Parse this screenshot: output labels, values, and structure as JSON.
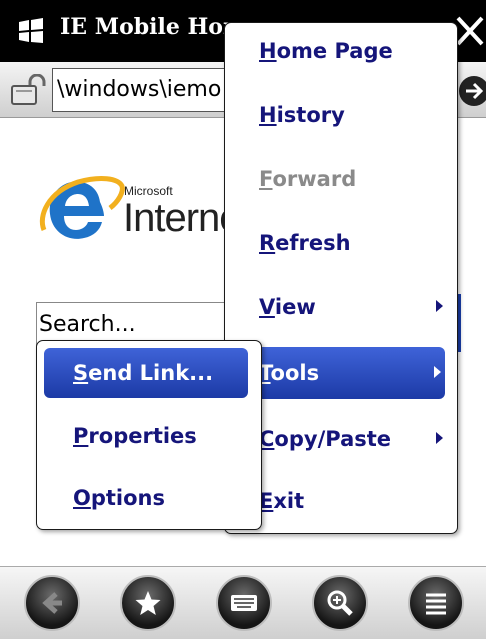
{
  "window": {
    "title": "IE Mobile Hom",
    "address": "\\windows\\iemo"
  },
  "page": {
    "logo_small": "Microsoft",
    "logo_large": "Interne",
    "search_placeholder": "Search..."
  },
  "menu": {
    "items": [
      {
        "label": "Home Page",
        "mnemonic": "H",
        "rest": "ome Page",
        "enabled": true
      },
      {
        "label": "History",
        "mnemonic": "H",
        "rest": "istory",
        "enabled": true
      },
      {
        "label": "Forward",
        "mnemonic": "F",
        "rest": "orward",
        "enabled": false
      },
      {
        "label": "Refresh",
        "mnemonic": "R",
        "rest": "efresh",
        "enabled": true
      },
      {
        "label": "View",
        "mnemonic": "V",
        "rest": "iew",
        "enabled": true
      },
      {
        "label": "Tools",
        "mnemonic": "T",
        "rest": "ools",
        "enabled": true
      },
      {
        "label": "Copy/Paste",
        "mnemonic": "C",
        "rest": "opy/Paste",
        "enabled": true
      },
      {
        "label": "Exit",
        "mnemonic": "E",
        "rest": "xit",
        "enabled": true
      }
    ],
    "selected": "Tools"
  },
  "submenu": {
    "items": [
      {
        "label": "Send Link...",
        "mnemonic": "S",
        "rest": "end Link..."
      },
      {
        "label": "Properties",
        "mnemonic": "P",
        "rest": "roperties"
      },
      {
        "label": "Options",
        "mnemonic": "O",
        "rest": "ptions"
      }
    ],
    "selected": "Send Link..."
  },
  "toolbar": {
    "buttons": [
      "back-icon",
      "favorites-icon",
      "keyboard-icon",
      "zoom-icon",
      "menu-icon"
    ]
  },
  "colors": {
    "menu_text": "#15157a",
    "selection": "#2a4bc0",
    "disabled_text": "#8a8a8a"
  }
}
